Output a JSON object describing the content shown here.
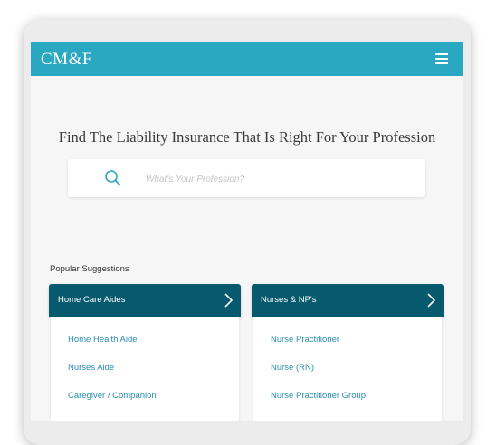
{
  "header": {
    "logo_text": "CM&F",
    "menu_icon": "hamburger-menu-icon",
    "bar_color": "#2aa7c1"
  },
  "hero": {
    "headline": "Find The Liability Insurance That Is Right For Your Profession",
    "search_icon": "search-icon",
    "search_placeholder": "What's Your Profession?"
  },
  "suggestions": {
    "label": "Popular Suggestions",
    "header_color": "#075a6e",
    "cards": [
      {
        "title": "Home Care Aides",
        "chevron_icon": "chevron-right-icon",
        "links": [
          "Home Health Aide",
          "Nurses Aide",
          "Caregiver / Companion"
        ]
      },
      {
        "title": "Nurses & NP's",
        "chevron_icon": "chevron-right-icon",
        "links": [
          "Nurse Practitioner",
          "Nurse (RN)",
          "Nurse Practitioner Group"
        ]
      }
    ]
  }
}
